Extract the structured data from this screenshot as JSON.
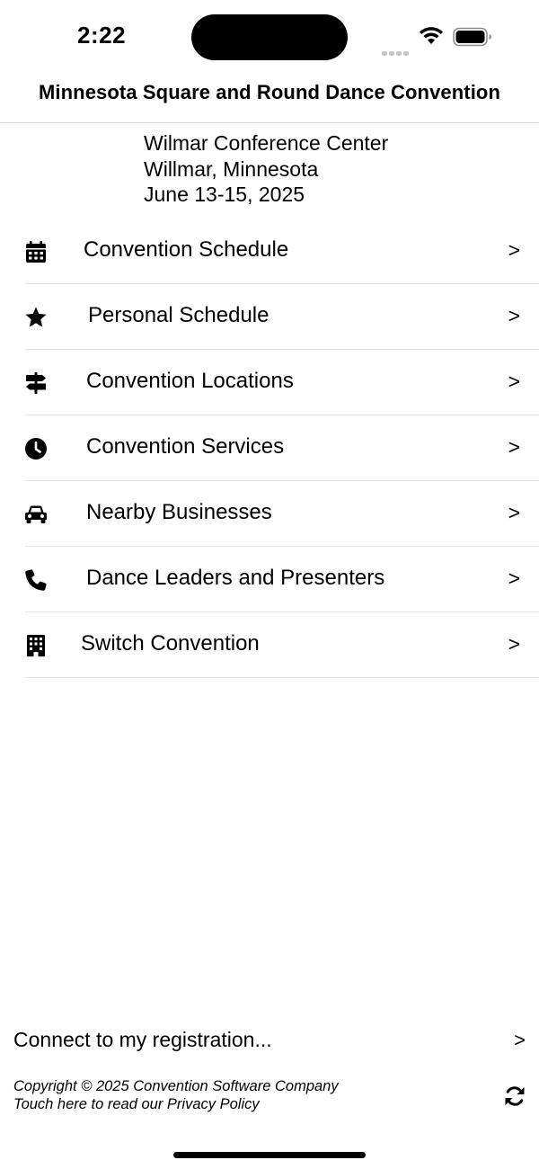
{
  "status_bar": {
    "time": "2:22"
  },
  "header": {
    "title": "Minnesota Square and Round Dance Convention"
  },
  "venue": {
    "name": "Wilmar Conference Center",
    "city": "Willmar, Minnesota",
    "dates": "June 13-15, 2025"
  },
  "menu": {
    "chevron": ">",
    "items": [
      {
        "label": "Convention Schedule",
        "icon": "calendar-icon"
      },
      {
        "label": "Personal Schedule",
        "icon": "star-icon"
      },
      {
        "label": "Convention Locations",
        "icon": "signpost-icon"
      },
      {
        "label": "Convention Services",
        "icon": "clock-icon"
      },
      {
        "label": "Nearby Businesses",
        "icon": "car-icon"
      },
      {
        "label": "Dance Leaders and Presenters",
        "icon": "phone-icon"
      },
      {
        "label": "Switch Convention",
        "icon": "building-icon"
      }
    ]
  },
  "footer": {
    "connect_label": "Connect to my registration...",
    "connect_chevron": ">",
    "copyright": "Copyright © 2025 Convention Software Company",
    "privacy": "Touch here to read our Privacy Policy",
    "refresh_icon": "refresh-icon"
  }
}
